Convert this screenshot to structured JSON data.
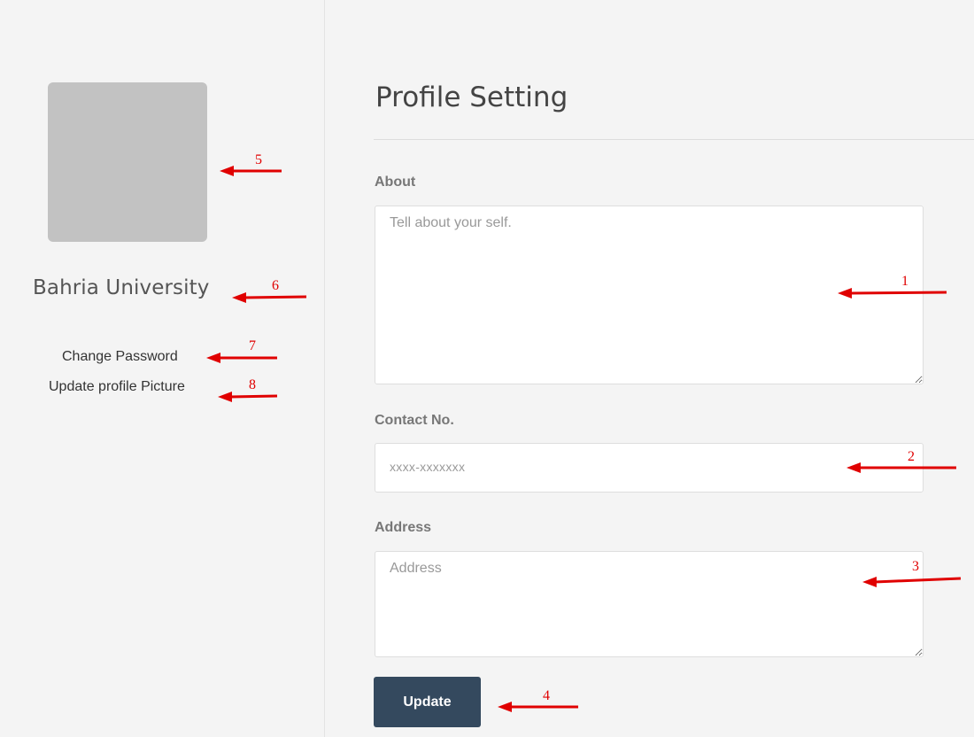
{
  "sidebar": {
    "user_name": "Bahria University",
    "links": {
      "change_password": "Change Password",
      "update_picture": "Update profile Picture"
    }
  },
  "main": {
    "title": "Profile Setting",
    "about": {
      "label": "About",
      "placeholder": "Tell about your self."
    },
    "contact": {
      "label": "Contact No.",
      "placeholder": "xxxx-xxxxxxx"
    },
    "address": {
      "label": "Address",
      "placeholder": "Address"
    },
    "update_label": "Update"
  },
  "annotations": {
    "color": "#e00000",
    "numbers": [
      "1",
      "2",
      "3",
      "4",
      "5",
      "6",
      "7",
      "8"
    ]
  },
  "colors": {
    "background": "#f4f4f4",
    "avatar_placeholder": "#c2c2c2",
    "button": "#34495e"
  }
}
